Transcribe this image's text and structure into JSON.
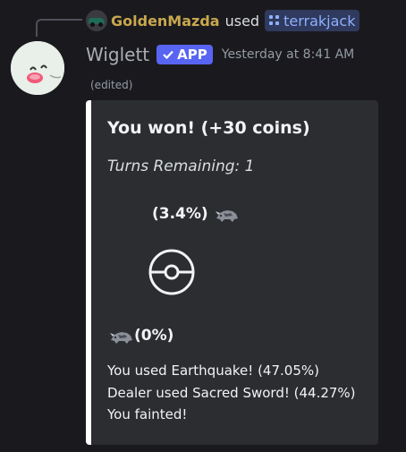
{
  "reply": {
    "author": "GoldenMazda",
    "verb": "used",
    "command": "terrakjack"
  },
  "message": {
    "username": "Wiglett",
    "app_badge": "APP",
    "timestamp": "Yesterday at 8:41 AM",
    "edited": "(edited)"
  },
  "embed": {
    "accent_color": "#ffffff",
    "title": "You won! (+30 coins)",
    "turns_remaining": "Turns Remaining: 1",
    "opponent_percent": "(3.4%)",
    "player_percent": "(0%)",
    "log": [
      "You used Earthquake! (47.05%)",
      "Dealer used Sacred Sword! (44.27%)",
      "You fainted!"
    ]
  },
  "icons": {
    "reply_avatar": "car-avatar-icon",
    "command": "slash-command-icon",
    "app_check": "checkmark-icon",
    "pokemon": "rhino-pokemon-icon",
    "pokeball": "pokeball-icon"
  },
  "colors": {
    "background": "#1a1a1e",
    "embed_bg": "#2b2d31",
    "app_badge": "#5865f2",
    "reply_author": "#c8a84e",
    "command_text": "#8fb0ff"
  }
}
